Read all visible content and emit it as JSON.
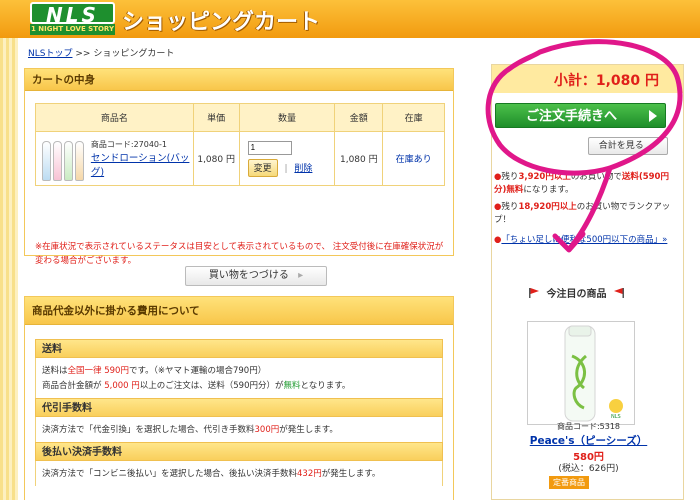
{
  "header": {
    "logo_main": "NLS",
    "logo_sub": "1 NIGHT LOVE STORY",
    "title": "ショッピングカート"
  },
  "breadcrumb": {
    "home": "NLSトップ",
    "separator": ">>",
    "current": "ショッピングカート"
  },
  "cart": {
    "heading": "カートの中身",
    "columns": [
      "商品名",
      "単価",
      "数量",
      "金額",
      "在庫"
    ],
    "item": {
      "code": "商品コード:27040-1",
      "name": "センドローション(バッグ)",
      "unit_price": "1,080 円",
      "quantity": "1",
      "change_label": "変更",
      "delete_label": "削除",
      "amount": "1,080 円",
      "stock": "在庫あり"
    },
    "note": "※在庫状況で表示されているステータスは目安として表示されているもので、 注文受付後に在庫確保状況が変わる場合がございます。",
    "continue_label": "買い物をつづける"
  },
  "costs": {
    "heading": "商品代金以外に掛かる費用について",
    "sections": [
      {
        "title": "送料",
        "lines": [
          [
            "送料は",
            "全国一律 590円",
            "です。（※ヤマト運輸の場合790円）"
          ],
          [
            "商品合計金額が ",
            "5,000 円",
            "以上のご注文は、送料（590円分）が",
            "無料",
            "となります。"
          ]
        ]
      },
      {
        "title": "代引手数料",
        "lines": [
          [
            "決済方法で「代金引換」を選択した場合、代引き手数料",
            "300円",
            "が発生します。"
          ]
        ]
      },
      {
        "title": "後払い決済手数料",
        "lines": [
          [
            "決済方法で「コンビニ後払い」を選択した場合、後払い決済手数料",
            "432円",
            "が発生します。"
          ]
        ]
      }
    ]
  },
  "side": {
    "subtotal": "小計：1,080 円",
    "order_label": "ご注文手続きへ",
    "view_total_label": "合計を見る",
    "info1": [
      "残り",
      "3,920円以上",
      "のお買い物で",
      "送料(590円分)",
      "無料",
      "になります。"
    ],
    "info2": [
      "残り",
      "18,920円以上",
      "のお買い物でランクアップ！"
    ],
    "info3": "「ちょい足しに便利な500円以下の商品」»",
    "featured_title": "今注目の商品",
    "featured_code": "商品コード:5318",
    "featured_name": "Peace's（ピーシーズ）",
    "featured_price": "580円",
    "featured_tax": "(税込：626円)",
    "featured_badge": "定番商品"
  },
  "colors": {
    "accent": "#f29a0f",
    "link": "#0033aa",
    "price_red": "#e0201a",
    "order_green": "#1e8e2a",
    "annotation_magenta": "#e0178a"
  }
}
